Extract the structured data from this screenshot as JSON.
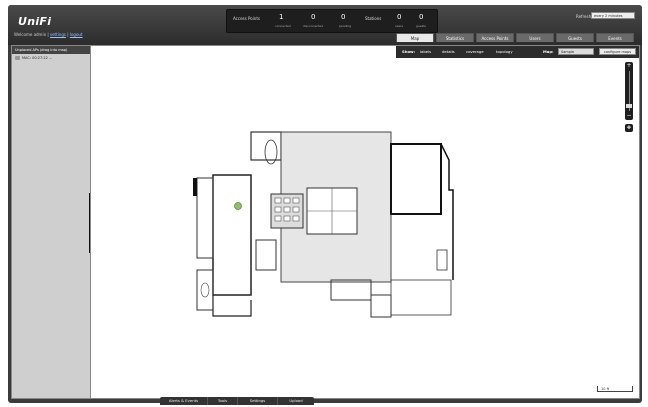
{
  "header": {
    "logo": "UniFi",
    "welcome_prefix": "Welcome admin |",
    "settings_link": "settings",
    "logout_link": "logout",
    "status_title": "Access Points",
    "stats": [
      {
        "value": "1",
        "label": "connected"
      },
      {
        "value": "0",
        "label": "disconnected"
      },
      {
        "value": "0",
        "label": "pending"
      }
    ],
    "stations_title": "Stations",
    "stations": [
      {
        "value": "0",
        "label": "users"
      },
      {
        "value": "0",
        "label": "guests"
      }
    ],
    "refresh_label": "Refresh",
    "refresh_value": "every 2 minutes"
  },
  "tabs": [
    {
      "label": "Map",
      "active": true
    },
    {
      "label": "Statistics",
      "active": false
    },
    {
      "label": "Access Points",
      "active": false
    },
    {
      "label": "Users",
      "active": false
    },
    {
      "label": "Guests",
      "active": false
    },
    {
      "label": "Events",
      "active": false
    }
  ],
  "sidebar": {
    "header": "Unplaced APs (drag into map)",
    "items": [
      {
        "label": "MAC: 00:27:22 ... ",
        "icon": "access-point-icon"
      }
    ]
  },
  "mapbar": {
    "show_label": "Show:",
    "options": [
      "labels",
      "details",
      "coverage",
      "topology"
    ],
    "map_label": "Map:",
    "map_value": "Sample",
    "configure_label": "configure maps"
  },
  "map": {
    "zoom_plus": "+",
    "zoom_minus": "−",
    "scale_label": "10 ft"
  },
  "bottombar": {
    "buttons": [
      "Alerts & Events",
      "Tools",
      "Settings",
      "Upload"
    ]
  }
}
